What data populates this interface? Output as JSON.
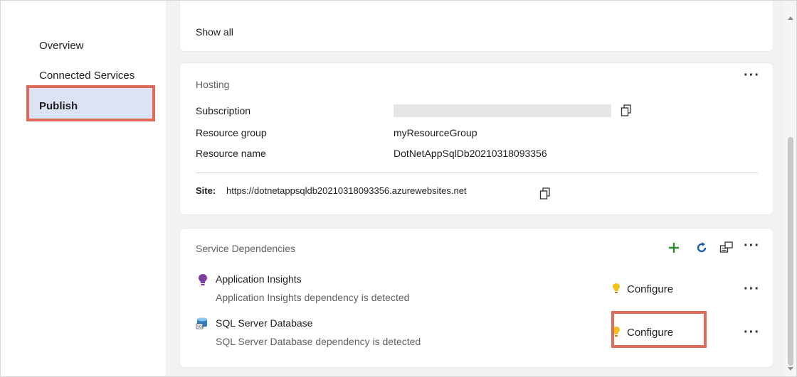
{
  "sidebar": {
    "items": [
      {
        "label": "Overview"
      },
      {
        "label": "Connected Services"
      },
      {
        "label": "Publish"
      }
    ]
  },
  "top_card": {
    "show_all_label": "Show all"
  },
  "hosting": {
    "title": "Hosting",
    "subscription_label": "Subscription",
    "resource_group_label": "Resource group",
    "resource_group_value": "myResourceGroup",
    "resource_name_label": "Resource name",
    "resource_name_value": "DotNetAppSqlDb20210318093356",
    "site_label": "Site:",
    "site_url": "https://dotnetappsqldb20210318093356.azurewebsites.net"
  },
  "service_dependencies": {
    "title": "Service Dependencies",
    "items": [
      {
        "name": "Application Insights",
        "description": "Application Insights dependency is detected",
        "action": "Configure",
        "icon": "application-insights-icon"
      },
      {
        "name": "SQL Server Database",
        "description": "SQL Server Database dependency is detected",
        "action": "Configure",
        "icon": "sql-database-icon"
      }
    ]
  },
  "colors": {
    "accent_link": "#0f62c9",
    "selected_nav_bg": "#dbe3f4",
    "highlight_border": "#e06b5b",
    "add_icon": "#2a8c2a",
    "insights_purple": "#7a3fa0",
    "lightbulb_yellow": "#f4c017"
  }
}
